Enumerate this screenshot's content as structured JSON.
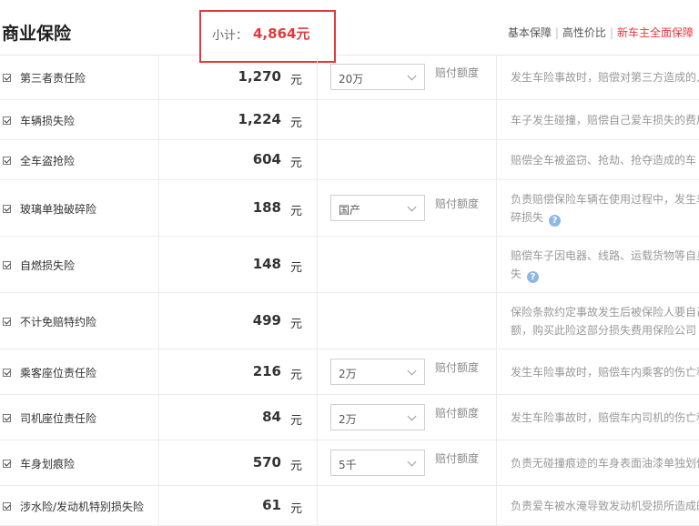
{
  "header": {
    "title": "商业保险",
    "subtotal_label": "小计：",
    "subtotal_value": "4,864元",
    "links": [
      "基本保障",
      "高性价比",
      "新车主全面保障"
    ],
    "separator": "|"
  },
  "unit_label": "元",
  "rows": [
    {
      "name": "第三者责任险",
      "price": "1,270",
      "select": "20万",
      "select_label": "赔付额度",
      "desc": [
        "发生车险事故时，赔偿对第三方造成的人"
      ],
      "help": false
    },
    {
      "name": "车辆损失险",
      "price": "1,224",
      "select": "",
      "select_label": "",
      "desc": [
        "车子发生碰撞，赔偿自己爱车损失的费用"
      ],
      "help": false
    },
    {
      "name": "全车盗抢险",
      "price": "604",
      "select": "",
      "select_label": "",
      "desc": [
        "赔偿全车被盗窃、抢劫、抢夺造成的车"
      ],
      "help": false
    },
    {
      "name": "玻璃单独破碎险",
      "price": "188",
      "select": "国产",
      "select_label": "赔付额度",
      "desc": [
        "负责赔偿保险车辆在使用过程中，发生车",
        "碎损失"
      ],
      "help": true
    },
    {
      "name": "自燃损失险",
      "price": "148",
      "select": "",
      "select_label": "",
      "desc": [
        "赔偿车子因电器、线路、运载货物等自身",
        "失"
      ],
      "help": true
    },
    {
      "name": "不计免赔特约险",
      "price": "499",
      "select": "",
      "select_label": "",
      "desc": [
        "保险条款约定事故发生后被保险人要自己",
        "额，购买此险这部分损失费用保险公司"
      ],
      "help": false
    },
    {
      "name": "乘客座位责任险",
      "price": "216",
      "select": "2万",
      "select_label": "赔付额度",
      "desc": [
        "发生车险事故时，赔偿车内乘客的伤亡和"
      ],
      "help": false
    },
    {
      "name": "司机座位责任险",
      "price": "84",
      "select": "2万",
      "select_label": "赔付额度",
      "desc": [
        "发生车险事故时，赔偿车内司机的伤亡和"
      ],
      "help": false
    },
    {
      "name": "车身划痕险",
      "price": "570",
      "select": "5千",
      "select_label": "赔付额度",
      "desc": [
        "负责无碰撞痕迹的车身表面油漆单独划伤"
      ],
      "help": false
    },
    {
      "name": "涉水险/发动机特别损失险",
      "price": "61",
      "select": "",
      "select_label": "",
      "desc": [
        "负责爱车被水淹导致发动机受损所造成的"
      ],
      "help": false
    }
  ],
  "colors": {
    "accent": "#e4393c",
    "help_icon": "#8fb7e6"
  }
}
